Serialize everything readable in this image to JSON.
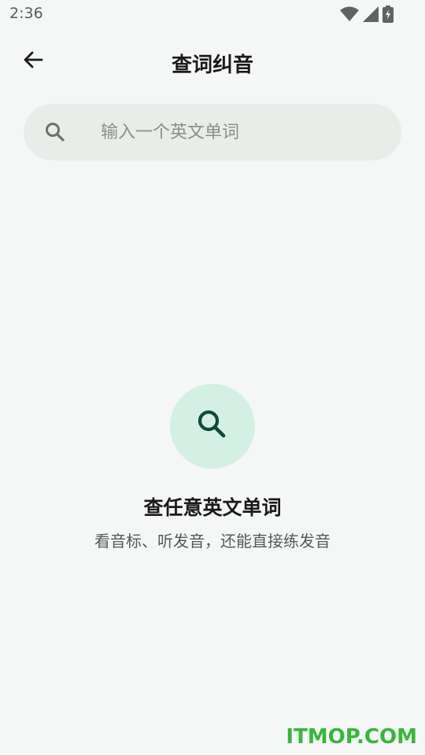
{
  "status_bar": {
    "time": "2:36",
    "icons": [
      "wifi-icon",
      "cell-signal-icon",
      "battery-charging-icon"
    ]
  },
  "app_bar": {
    "back_icon": "arrow-back-icon",
    "title": "查词纠音"
  },
  "search": {
    "icon": "search-icon",
    "value": "",
    "placeholder": "输入一个英文单词"
  },
  "empty_state": {
    "icon": "search-icon",
    "title": "查任意英文单词",
    "subtitle": "看音标、听发音，还能直接练发音"
  },
  "watermark": "ITMOP.COM",
  "colors": {
    "background": "#f5f7f6",
    "search_bg": "#e8ede9",
    "accent_circle": "#d4efe4",
    "accent_icon": "#0f4a38",
    "watermark": "#35b837"
  }
}
